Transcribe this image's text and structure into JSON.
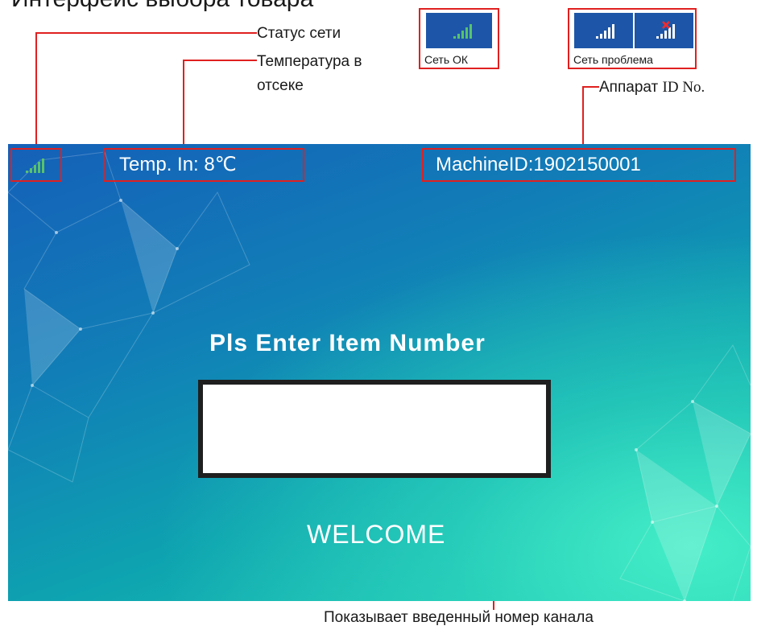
{
  "page_title": "Интерфейс выбора товара",
  "annotations": {
    "network_status": "Статус сети",
    "temperature_line1": "Температура в",
    "temperature_line2": "отсеке",
    "machine_id_prefix": "Аппарат",
    "machine_id_suffix": "ID No.",
    "entry_box": "Показывает введенный номер канала"
  },
  "legend": {
    "network_ok": "Сеть ОК",
    "network_problem": "Сеть проблема"
  },
  "screen": {
    "temperature": "Temp. In: 8℃",
    "machine_id": "MachineID:1902150001",
    "prompt": "Pls Enter Item Number",
    "entered_value": "",
    "welcome": "WELCOME"
  },
  "colors": {
    "annotation_red": "#e02020",
    "signal_green": "#58c36a",
    "icon_blue": "#1d56a8",
    "screen_blue": "#1560b8",
    "screen_teal": "#23d0b6"
  },
  "icons": {
    "signal": "signal-bars-icon",
    "no_signal": "signal-bars-cross-icon"
  }
}
